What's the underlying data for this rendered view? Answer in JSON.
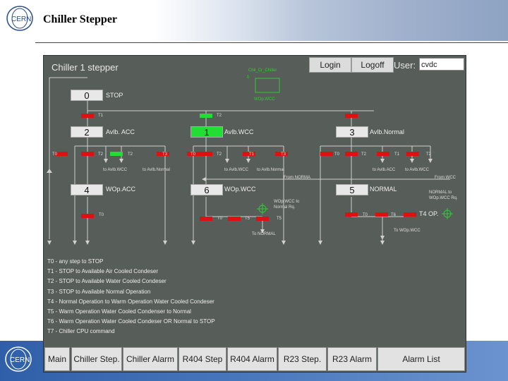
{
  "slide": {
    "title": "Chiller Stepper"
  },
  "panel": {
    "title": "Chiller 1 stepper",
    "login_label": "Login",
    "logoff_label": "Logoff",
    "user_label": "User:",
    "user_value": "cvdc",
    "indicator_label": "Chil_Cr_Chiller",
    "indicator_sub": "WOp.WCC",
    "indicator_small": "0"
  },
  "states": [
    {
      "id": "0",
      "label": "STOP"
    },
    {
      "id": "2",
      "label": "Avlb. ACC"
    },
    {
      "id": "1",
      "label": "Avlb.WCC"
    },
    {
      "id": "3",
      "label": "Avlb.Normal"
    },
    {
      "id": "4",
      "label": "WOp.ACC"
    },
    {
      "id": "6",
      "label": "WOp.WCC"
    },
    {
      "id": "5",
      "label": "NORMAL"
    }
  ],
  "transitions": {
    "t1": "T1",
    "t2": "T2",
    "t3": "T3",
    "t0": "T0",
    "t5": "T5",
    "t6": "T6",
    "t4op": "T4 OP.",
    "to_avlb_wcc": "to Avlb.WCC",
    "to_avlb_normal": "to Avlb.Normal",
    "to_avlb_acc": "to Avlb.ACC",
    "from_normal": "From NORMA",
    "from_wcc": "From WCC",
    "to_normal": "To NORMAL",
    "to_wop_wcc": "To WOp.WCC",
    "normal_to_wopwcc_1": "NORMAL to",
    "normal_to_wopwcc_2": "WOp.WCC Rq.",
    "wop_to_normal_1": "WOp.WCC to",
    "wop_to_normal_2": "Normal Rq."
  },
  "legend": [
    "T0 - any step to STOP",
    "T1 - STOP to Available Air Cooled Condeser",
    "T2 - STOP to Available Water Cooled Condeser",
    "T3 - STOP to Available Normal Operation",
    "T4 - Normal Operation to Warm Operation Water Cooled Condeser",
    "T5 - Warm Operation Water Cooled Condenser to Normal",
    "T6 - Warm Operation Water Cooled Condeser OR Normal to STOP",
    "T7 - Chiller CPU command"
  ],
  "nav": [
    "Main",
    "Chiller Step.",
    "Chiller Alarm",
    "R404 Step",
    "R404 Alarm",
    "R23 Step.",
    "R23 Alarm",
    "Alarm List"
  ],
  "colors": {
    "active_state": "#22dd33",
    "transition_red": "#dd1111",
    "panel_bg": "#575d59"
  }
}
